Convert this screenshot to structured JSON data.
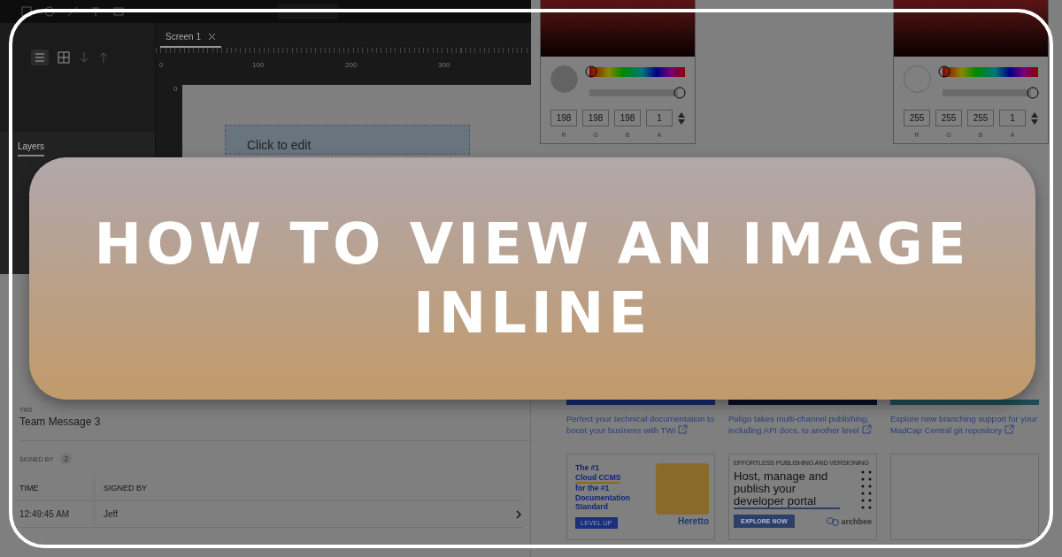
{
  "editor": {
    "tabs": [
      {
        "label": "Screen 1",
        "selected": true
      }
    ],
    "ruler_labels": [
      "0",
      "100",
      "200",
      "300"
    ],
    "vertical_ruler_label": "0",
    "canvas_text": "Click to edit",
    "panel_tabs": [
      {
        "label": "Layers",
        "selected": true
      }
    ]
  },
  "color_pickers": [
    {
      "hue": {
        "level": 0
      },
      "alpha": {
        "level": 1
      },
      "channels": [
        {
          "label": "R",
          "value": "198"
        },
        {
          "label": "G",
          "value": "198"
        },
        {
          "label": "B",
          "value": "198"
        },
        {
          "label": "A",
          "value": "1"
        }
      ]
    },
    {
      "hue": {
        "level": 0
      },
      "alpha": {
        "level": 1
      },
      "channels": [
        {
          "label": "R",
          "value": "255"
        },
        {
          "label": "G",
          "value": "255"
        },
        {
          "label": "B",
          "value": "255"
        },
        {
          "label": "A",
          "value": "1"
        }
      ]
    }
  ],
  "form": {
    "fields": [
      {
        "label": "TM3",
        "value": "Team Message 3"
      }
    ],
    "signed_by": {
      "label": "SIGNED BY",
      "count": "2"
    },
    "table": {
      "columns": [
        "TIME",
        "SIGNED BY"
      ],
      "rows": [
        {
          "cells": [
            "12:49:45 AM",
            "Jeff"
          ]
        }
      ]
    }
  },
  "sponsored": {
    "cards": [
      {
        "caption": "Perfect your technical documentation to boost your business with TWi"
      },
      {
        "caption": "Paligo takes multi-channel publishing, including API docs, to another level"
      },
      {
        "caption": "Explore new branching support for your MadCap Central git repository"
      }
    ],
    "ads": [
      {
        "kind": "heretto",
        "headline": [
          "The #1",
          "Cloud CCMS",
          "for the #1",
          "Documentation",
          "Standard"
        ],
        "button": "LEVEL UP",
        "brand": "Heretto"
      },
      {
        "kind": "archbee",
        "eyebrow": "EFFORTLESS PUBLISHING AND VERSIONING",
        "headline": "Host, manage and publish your developer portal",
        "button": "EXPLORE NOW",
        "brand": "archbee"
      },
      {
        "kind": "blank"
      }
    ]
  },
  "banner": {
    "lines": [
      "HOW TO VIEW AN IMAGE",
      "INLINE"
    ]
  }
}
